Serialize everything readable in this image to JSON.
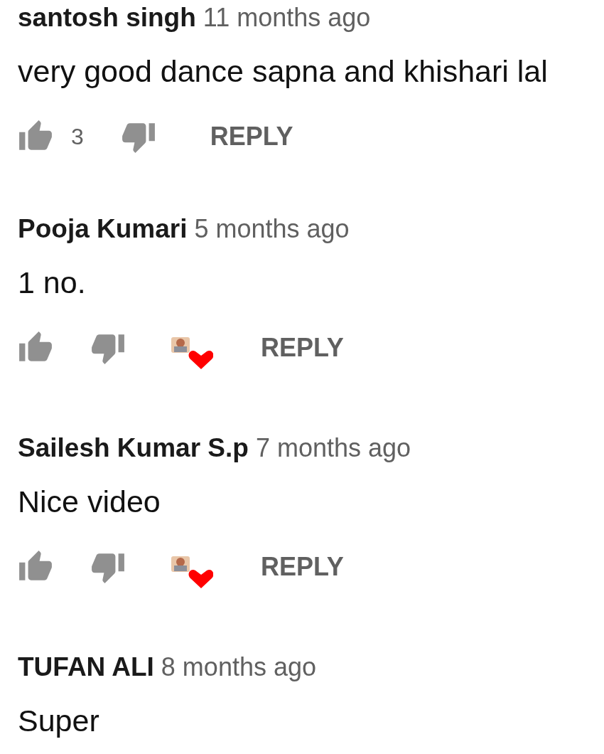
{
  "comments": [
    {
      "author": "santosh singh",
      "time": "11 months ago",
      "text": "very good dance sapna and khishari lal",
      "likes": "3",
      "hearted": false,
      "reply": "REPLY"
    },
    {
      "author": "Pooja Kumari",
      "time": "5 months ago",
      "text": "1 no.",
      "hearted": true,
      "reply": "REPLY"
    },
    {
      "author": "Sailesh Kumar S.p",
      "time": "7 months ago",
      "text": "Nice video",
      "hearted": true,
      "reply": "REPLY"
    },
    {
      "author": "TUFAN ALI",
      "time": "8 months ago",
      "text": "Super"
    }
  ]
}
